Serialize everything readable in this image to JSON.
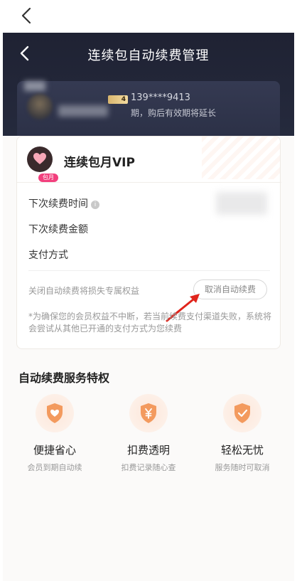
{
  "header": {
    "title": "连续包自动续费管理"
  },
  "user": {
    "level": "4",
    "phone": "139****9413",
    "expire_note": "期，购后有效期将延长"
  },
  "card": {
    "title": "连续包月VIP",
    "vip_tag": "包月",
    "rows": [
      {
        "label": "下次续费时间"
      },
      {
        "label": "下次续费金额"
      },
      {
        "label": "支付方式"
      }
    ],
    "lose_text": "关闭自动续费将损失专属权益",
    "cancel_button": "取消自动续费",
    "note": "*为确保您的会员权益不中断，若当前续费支付渠道失败，系统将会尝试从其他已开通的支付方式为您续费"
  },
  "features": {
    "title": "自动续费服务特权",
    "items": [
      {
        "title": "便捷省心",
        "subtitle": "会员到期自动续",
        "icon": "heart-shield-icon"
      },
      {
        "title": "扣费透明",
        "subtitle": "扣费记录随心查",
        "icon": "yen-shield-icon"
      },
      {
        "title": "轻松无忧",
        "subtitle": "服务随时可取消",
        "icon": "check-shield-icon"
      }
    ]
  },
  "colors": {
    "header_bg": "#1f2233",
    "accent_orange": "#f39a5e",
    "arrow_red": "#e0241b",
    "vip_pink": "#f23f7d"
  }
}
